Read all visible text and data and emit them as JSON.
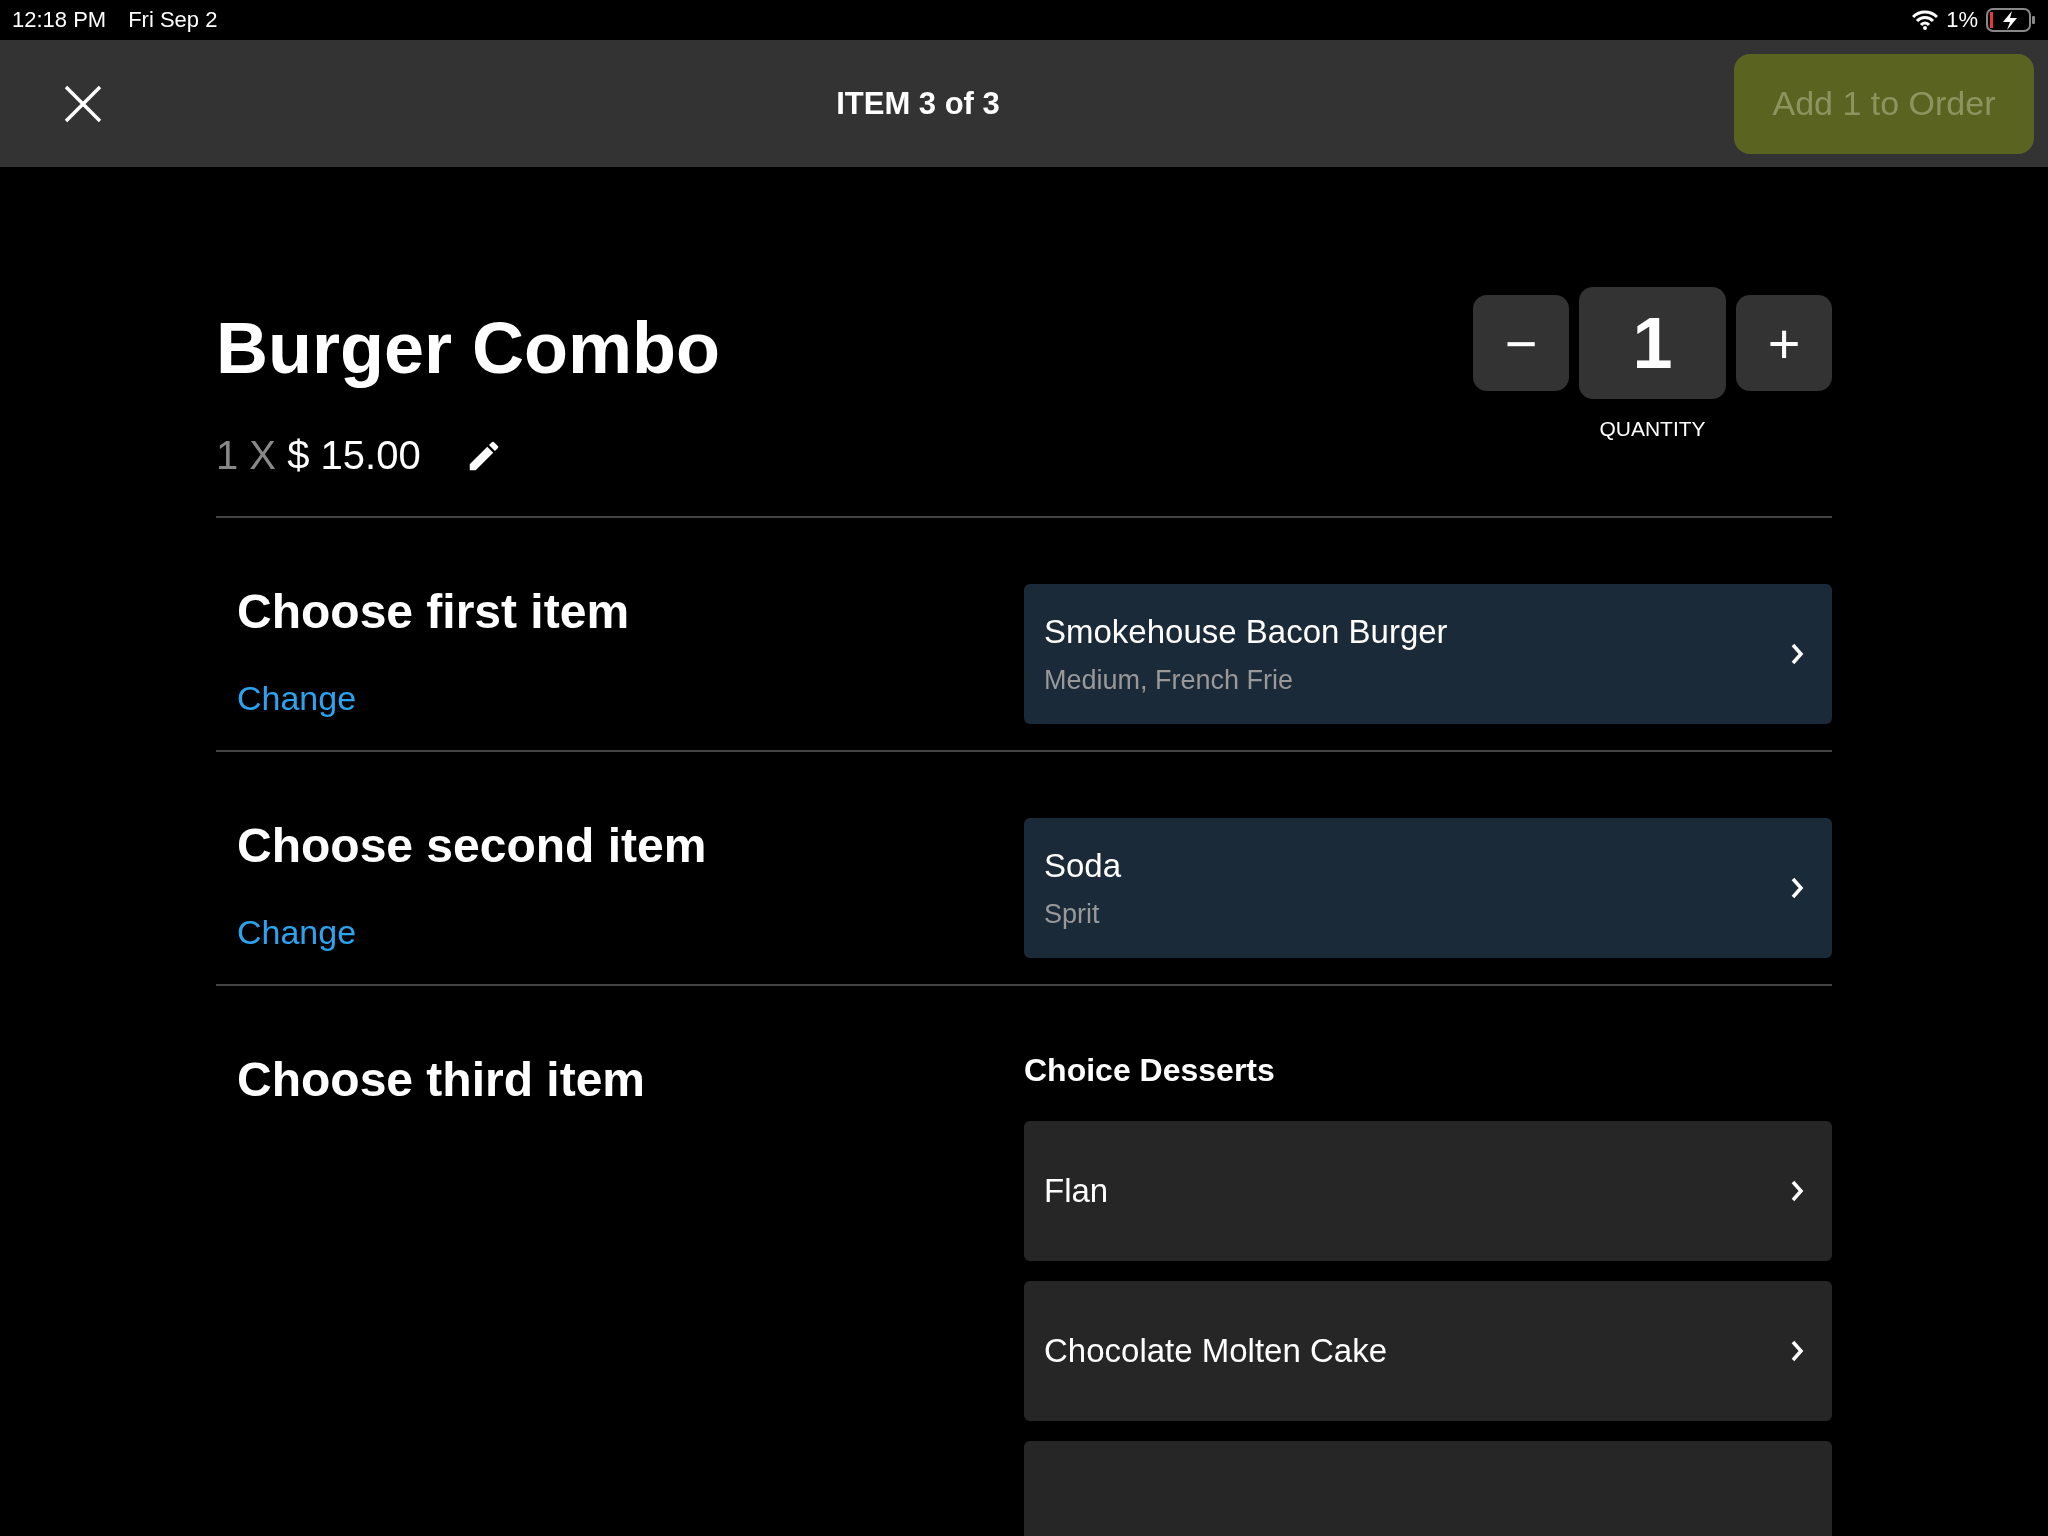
{
  "status_bar": {
    "time": "12:18 PM",
    "date": "Fri Sep 2",
    "battery": "1%"
  },
  "header": {
    "title": "ITEM 3 of 3",
    "action": "Add 1 to Order"
  },
  "item": {
    "name": "Burger Combo",
    "multiplier": "1 X",
    "price": "$ 15.00"
  },
  "quantity": {
    "minus": "−",
    "value": "1",
    "plus": "+",
    "label": "QUANTITY"
  },
  "sections": [
    {
      "title": "Choose first item",
      "change": "Change",
      "selection": {
        "name": "Smokehouse Bacon Burger",
        "detail": "Medium,  French Frie"
      }
    },
    {
      "title": "Choose second item",
      "change": "Change",
      "selection": {
        "name": "Soda",
        "detail": "Sprit"
      }
    },
    {
      "title": "Choose third item",
      "group": "Choice Desserts",
      "options": [
        {
          "name": "Flan"
        },
        {
          "name": "Chocolate Molten Cake"
        }
      ]
    }
  ]
}
